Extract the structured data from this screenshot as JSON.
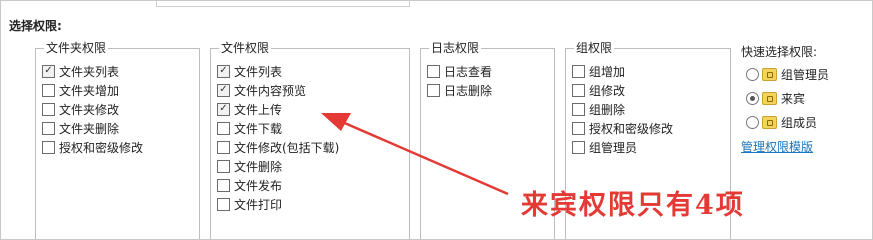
{
  "section_title": "选择权限:",
  "groups": [
    {
      "legend": "文件夹权限",
      "items": [
        {
          "label": "文件夹列表",
          "checked": true
        },
        {
          "label": "文件夹增加",
          "checked": false
        },
        {
          "label": "文件夹修改",
          "checked": false
        },
        {
          "label": "文件夹删除",
          "checked": false
        },
        {
          "label": "授权和密级修改",
          "checked": false
        }
      ]
    },
    {
      "legend": "文件权限",
      "items": [
        {
          "label": "文件列表",
          "checked": true
        },
        {
          "label": "文件内容预览",
          "checked": true
        },
        {
          "label": "文件上传",
          "checked": true
        },
        {
          "label": "文件下载",
          "checked": false
        },
        {
          "label": "文件修改(包括下载)",
          "checked": false
        },
        {
          "label": "文件删除",
          "checked": false
        },
        {
          "label": "文件发布",
          "checked": false
        },
        {
          "label": "文件打印",
          "checked": false
        }
      ]
    },
    {
      "legend": "日志权限",
      "items": [
        {
          "label": "日志查看",
          "checked": false
        },
        {
          "label": "日志删除",
          "checked": false
        }
      ]
    },
    {
      "legend": "组权限",
      "items": [
        {
          "label": "组增加",
          "checked": false
        },
        {
          "label": "组修改",
          "checked": false
        },
        {
          "label": "组删除",
          "checked": false
        },
        {
          "label": "授权和密级修改",
          "checked": false
        },
        {
          "label": "组管理员",
          "checked": false
        }
      ]
    }
  ],
  "quick": {
    "title": "快速选择权限:",
    "options": [
      {
        "label": "组管理员",
        "selected": false,
        "icon": "group-icon"
      },
      {
        "label": "来宾",
        "selected": true,
        "icon": "group-icon"
      },
      {
        "label": "组成员",
        "selected": false,
        "icon": "group-icon"
      }
    ],
    "link": "管理权限模版"
  },
  "annotation": "来宾权限只有4项",
  "colors": {
    "annotation": "#e53935",
    "link": "#1b75bc"
  }
}
